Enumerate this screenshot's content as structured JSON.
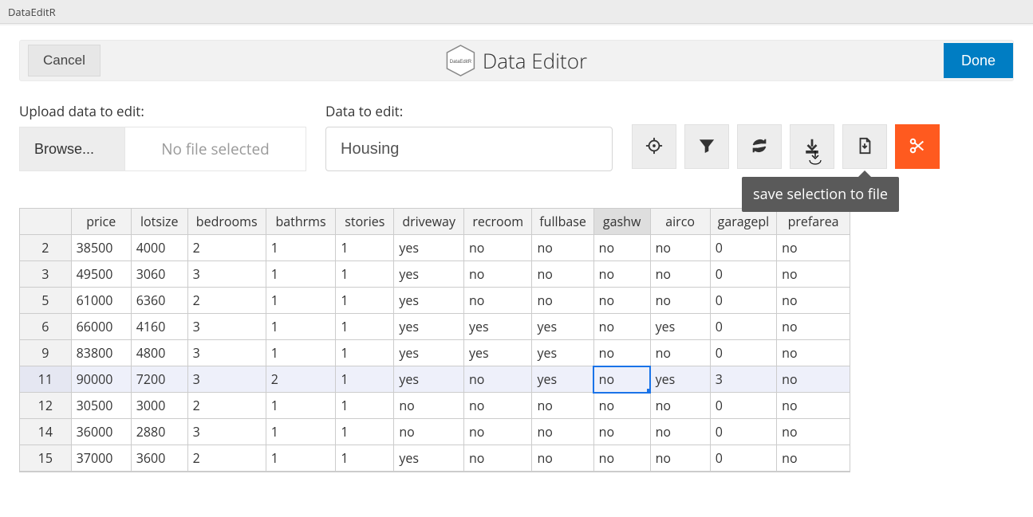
{
  "app_name": "DataEditR",
  "header": {
    "cancel": "Cancel",
    "title": "Data Editor",
    "done": "Done",
    "logo_text": "DataEditR"
  },
  "upload": {
    "label": "Upload data to edit:",
    "browse": "Browse...",
    "file_status": "No file selected"
  },
  "dataset": {
    "label": "Data to edit:",
    "value": "Housing"
  },
  "toolbar": {
    "select_tooltip": "select",
    "filter_tooltip": "filter",
    "sync_tooltip": "sync",
    "download_tooltip": "save selection to file",
    "export_tooltip": "export",
    "cut_tooltip": "cut"
  },
  "tooltip_text": "save selection to file",
  "table": {
    "columns": [
      "price",
      "lotsize",
      "bedrooms",
      "bathrms",
      "stories",
      "driveway",
      "recroom",
      "fullbase",
      "gashw",
      "airco",
      "garagepl",
      "prefarea"
    ],
    "highlight_col": "gashw",
    "selected_row_index": 5,
    "selected_col_index": 8,
    "rows": [
      {
        "n": 2,
        "v": [
          "38500",
          "4000",
          "2",
          "1",
          "1",
          "yes",
          "no",
          "no",
          "no",
          "no",
          "0",
          "no"
        ]
      },
      {
        "n": 3,
        "v": [
          "49500",
          "3060",
          "3",
          "1",
          "1",
          "yes",
          "no",
          "no",
          "no",
          "no",
          "0",
          "no"
        ]
      },
      {
        "n": 5,
        "v": [
          "61000",
          "6360",
          "2",
          "1",
          "1",
          "yes",
          "no",
          "no",
          "no",
          "no",
          "0",
          "no"
        ]
      },
      {
        "n": 6,
        "v": [
          "66000",
          "4160",
          "3",
          "1",
          "1",
          "yes",
          "yes",
          "yes",
          "no",
          "yes",
          "0",
          "no"
        ]
      },
      {
        "n": 9,
        "v": [
          "83800",
          "4800",
          "3",
          "1",
          "1",
          "yes",
          "yes",
          "yes",
          "no",
          "no",
          "0",
          "no"
        ]
      },
      {
        "n": 11,
        "v": [
          "90000",
          "7200",
          "3",
          "2",
          "1",
          "yes",
          "no",
          "yes",
          "no",
          "yes",
          "3",
          "no"
        ]
      },
      {
        "n": 12,
        "v": [
          "30500",
          "3000",
          "2",
          "1",
          "1",
          "no",
          "no",
          "no",
          "no",
          "no",
          "0",
          "no"
        ]
      },
      {
        "n": 14,
        "v": [
          "36000",
          "2880",
          "3",
          "1",
          "1",
          "no",
          "no",
          "no",
          "no",
          "no",
          "0",
          "no"
        ]
      },
      {
        "n": 15,
        "v": [
          "37000",
          "3600",
          "2",
          "1",
          "1",
          "yes",
          "no",
          "no",
          "no",
          "no",
          "0",
          "no"
        ]
      }
    ]
  }
}
